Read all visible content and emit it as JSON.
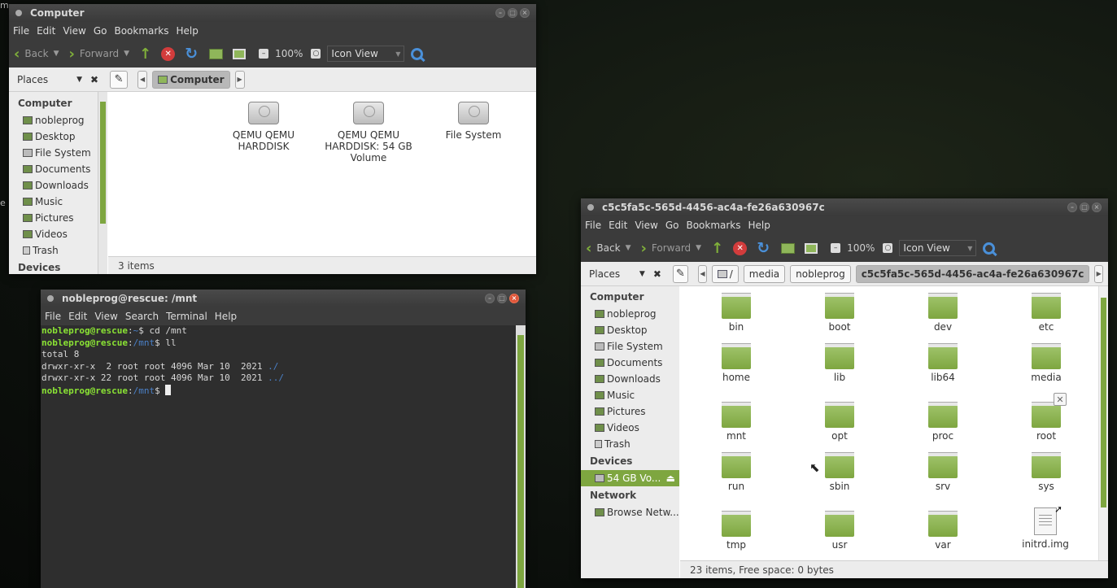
{
  "desktop": {
    "edge_text_top": "m",
    "edge_text_mid": "e"
  },
  "win1": {
    "title": "Computer",
    "menu": [
      "File",
      "Edit",
      "View",
      "Go",
      "Bookmarks",
      "Help"
    ],
    "toolbar": {
      "back": "Back",
      "forward": "Forward",
      "zoom": "100%",
      "view": "Icon View"
    },
    "places_label": "Places",
    "breadcrumb": "Computer",
    "sidebar": {
      "heading": "Computer",
      "items": [
        "nobleprog",
        "Desktop",
        "File System",
        "Documents",
        "Downloads",
        "Music",
        "Pictures",
        "Videos",
        "Trash"
      ],
      "heading2": "Devices"
    },
    "items": [
      {
        "name": "QEMU QEMU HARDDISK",
        "l1": "QEMU QEMU",
        "l2": "HARDDISK",
        "l3": ""
      },
      {
        "name": "QEMU QEMU HARDDISK: 54 GB Volume",
        "l1": "QEMU QEMU",
        "l2": "HARDDISK: 54 GB",
        "l3": "Volume"
      },
      {
        "name": "File System",
        "l1": "File System",
        "l2": "",
        "l3": ""
      }
    ],
    "status": "3 items"
  },
  "terminal": {
    "title": "nobleprog@rescue: /mnt",
    "menu": [
      "File",
      "Edit",
      "View",
      "Search",
      "Terminal",
      "Help"
    ],
    "lines": [
      {
        "user": "nobleprog@rescue",
        "path": "~",
        "cmd": "$ cd /mnt"
      },
      {
        "user": "nobleprog@rescue",
        "path": "/mnt",
        "cmd": "$ ll"
      },
      {
        "text": "total 8"
      },
      {
        "text": "drwxr-xr-x  2 root root 4096 Mar 10  2021 ",
        "dir": "./"
      },
      {
        "text": "drwxr-xr-x 22 root root 4096 Mar 10  2021 ",
        "dir": "../"
      },
      {
        "user": "nobleprog@rescue",
        "path": "/mnt",
        "cmd": "$ "
      }
    ]
  },
  "win2": {
    "title": "c5c5fa5c-565d-4456-ac4a-fe26a630967c",
    "menu": [
      "File",
      "Edit",
      "View",
      "Go",
      "Bookmarks",
      "Help"
    ],
    "toolbar": {
      "back": "Back",
      "forward": "Forward",
      "zoom": "100%",
      "view": "Icon View"
    },
    "places_label": "Places",
    "breadcrumbs": [
      "/",
      "media",
      "nobleprog",
      "c5c5fa5c-565d-4456-ac4a-fe26a630967c"
    ],
    "sidebar": {
      "heading": "Computer",
      "items": [
        "nobleprog",
        "Desktop",
        "File System",
        "Documents",
        "Downloads",
        "Music",
        "Pictures",
        "Videos",
        "Trash"
      ],
      "devices_heading": "Devices",
      "device": "54 GB Vo...",
      "network_heading": "Network",
      "network_item": "Browse Netw..."
    },
    "folders": [
      "bin",
      "boot",
      "dev",
      "etc",
      "home",
      "lib",
      "lib64",
      "media",
      "mnt",
      "opt",
      "proc",
      "root",
      "run",
      "sbin",
      "srv",
      "sys",
      "tmp",
      "usr",
      "var"
    ],
    "file": "initrd.img",
    "status": "23 items, Free space: 0 bytes"
  }
}
